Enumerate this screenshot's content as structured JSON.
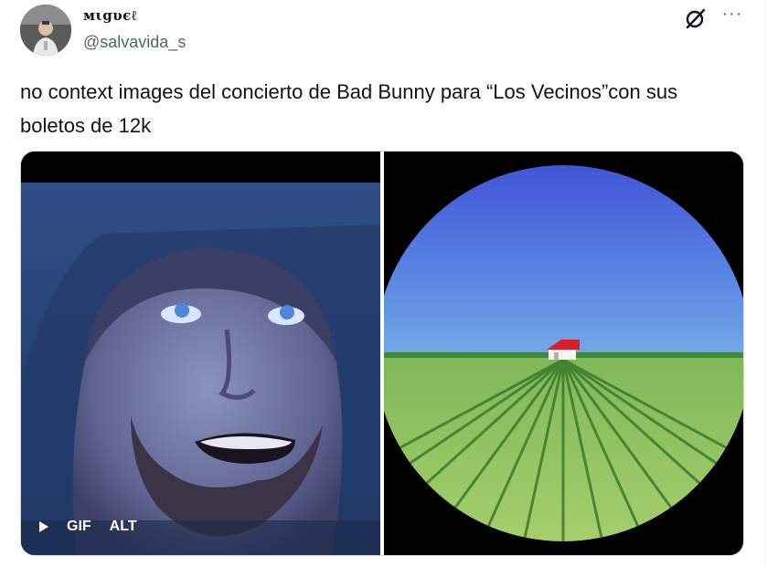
{
  "user": {
    "display_name": "мιgυєℓ",
    "handle": "@salvavida_s"
  },
  "actions": {
    "grok_icon": "grok-icon",
    "more_icon": "more-icon",
    "more_label": "···"
  },
  "tweet": {
    "text": "no context images del concierto de Bad Bunny para “Los Vecinos”con sus boletos de 12k"
  },
  "media": {
    "gif_label": "GIF",
    "alt_label": "ALT",
    "play_icon": "play-icon"
  }
}
